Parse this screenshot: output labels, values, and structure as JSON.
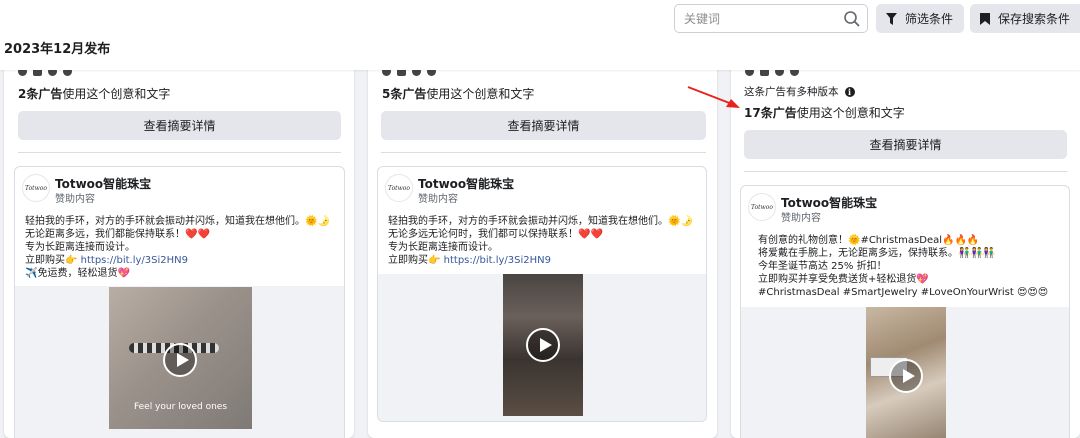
{
  "header": {
    "date_heading": "2023年12月发布",
    "search_placeholder": "关键词",
    "filter_label": "筛选条件",
    "save_search_label": "保存搜索条件"
  },
  "cards": [
    {
      "count_bold": "2条广告",
      "count_rest": "使用这个创意和文字",
      "summary_button": "查看摘要详情",
      "advertiser": "Totwoo智能珠宝",
      "logo_text": "Totwoo",
      "sponsored": "赞助内容",
      "body_lines": [
        "轻拍我的手环，对方的手环就会振动并闪烁，知道我在想他们。🌞🌛",
        "无论距离多远，我们都能保持联系！❤️❤️",
        "专为长距离连接而设计。"
      ],
      "buy_prefix": "立即购买👉",
      "link": "https://bit.ly/3Si2HN9",
      "extra_line": "✈️免运费，轻松退货💖",
      "video_caption": "Feel your loved ones"
    },
    {
      "count_bold": "5条广告",
      "count_rest": "使用这个创意和文字",
      "summary_button": "查看摘要详情",
      "advertiser": "Totwoo智能珠宝",
      "logo_text": "Totwoo",
      "sponsored": "赞助内容",
      "body_lines": [
        "轻拍我的手环，对方的手环就会振动并闪烁，知道我在想他们。🌞🌛",
        "无论多远无论何时，我们都可以保持联系！❤️❤️",
        "专为长距离连接而设计。"
      ],
      "buy_prefix": "立即购买👉",
      "link": "https://bit.ly/3Si2HN9"
    },
    {
      "multi_version": "这条广告有多种版本",
      "count_bold": "17条广告",
      "count_rest": "使用这个创意和文字",
      "summary_button": "查看摘要详情",
      "advertiser": "Totwoo智能珠宝",
      "logo_text": "Totwoo",
      "sponsored": "赞助内容",
      "body_lines": [
        "有创意的礼物创意！🌞#ChristmasDeal🔥🔥🔥",
        "将爱戴在手腕上，无论距离多远，保持联系。👫👫👫",
        "今年圣诞节高达 25% 折扣！",
        "立即购买并享受免费送货+轻松退货💖",
        "#ChristmasDeal #SmartJewelry #LoveOnYourWrist 😍😍😍"
      ]
    }
  ],
  "colors": {
    "annotation_arrow": "#e8231c",
    "link": "#385898"
  }
}
